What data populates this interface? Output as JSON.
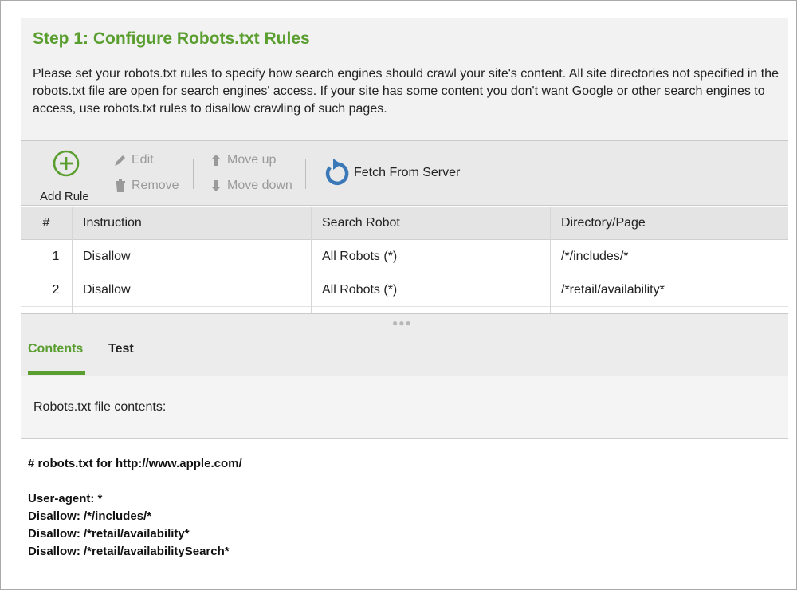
{
  "header": {
    "title": "Step 1: Configure Robots.txt Rules",
    "description": "Please set your robots.txt rules to specify how search engines should crawl your site's content. All site directories not specified in the robots.txt file are open for search engines' access. If your site has some content you don't want Google or other search engines to access, use robots.txt rules to disallow crawling of such pages."
  },
  "toolbar": {
    "add_rule": "Add Rule",
    "edit": "Edit",
    "remove": "Remove",
    "move_up": "Move up",
    "move_down": "Move down",
    "fetch": "Fetch From Server"
  },
  "table": {
    "columns": [
      "#",
      "Instruction",
      "Search Robot",
      "Directory/Page"
    ],
    "rows": [
      {
        "num": "1",
        "instruction": "Disallow",
        "robot": "All Robots (*)",
        "path": "/*/includes/*"
      },
      {
        "num": "2",
        "instruction": "Disallow",
        "robot": "All Robots (*)",
        "path": "/*retail/availability*"
      }
    ]
  },
  "tabs": {
    "contents": "Contents",
    "test": "Test",
    "active": "Contents"
  },
  "contents": {
    "label": "Robots.txt file contents:",
    "lines": [
      "# robots.txt for http://www.apple.com/",
      "",
      "User-agent: *",
      "Disallow: /*/includes/*",
      "Disallow: /*retail/availability*",
      "Disallow: /*retail/availabilitySearch*"
    ]
  },
  "colors": {
    "accent": "#5a9e2f",
    "fetch_icon": "#3a78b8",
    "disabled_text": "#9a9a9a"
  }
}
